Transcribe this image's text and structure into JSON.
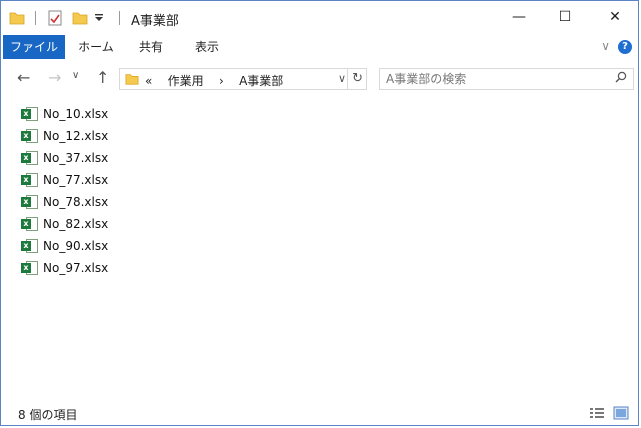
{
  "window": {
    "title": "A事業部"
  },
  "title_controls": {
    "minimize": "—",
    "maximize": "☐",
    "close": "✕"
  },
  "ribbon": {
    "tabs": [
      "ファイル",
      "ホーム",
      "共有",
      "表示"
    ],
    "expand_glyph": "∨",
    "help_glyph": "?"
  },
  "nav": {
    "back": "←",
    "forward": "→",
    "up": "↑",
    "breadcrumb_prefix": "«",
    "breadcrumb": [
      "作業用",
      "A事業部"
    ],
    "breadcrumb_sep": "›",
    "dropdown": "∨",
    "refresh": "↻"
  },
  "search": {
    "placeholder": "A事業部の検索",
    "icon_glyph": "⚲"
  },
  "files": [
    "No_10.xlsx",
    "No_12.xlsx",
    "No_37.xlsx",
    "No_77.xlsx",
    "No_78.xlsx",
    "No_82.xlsx",
    "No_90.xlsx",
    "No_97.xlsx"
  ],
  "file_icon_letter": "x",
  "status": {
    "item_count": "8 個の項目"
  },
  "colors": {
    "accent": "#1967c4",
    "excel_green": "#1d7a3c",
    "border": "#5b84c5",
    "folder": "#f5c94e"
  }
}
